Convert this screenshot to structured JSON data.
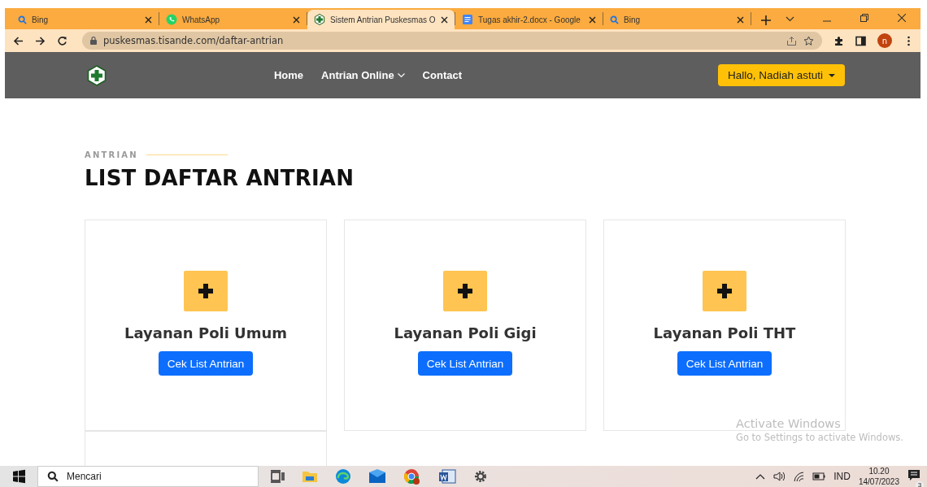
{
  "browser": {
    "tabs": [
      {
        "title": "Bing",
        "kind": "search",
        "selected": false
      },
      {
        "title": "WhatsApp",
        "kind": "chat",
        "selected": false
      },
      {
        "title": "Sistem Antrian Puskesmas O",
        "kind": "site",
        "selected": true
      },
      {
        "title": "Tugas akhir-2.docx - Google",
        "kind": "doc",
        "selected": false
      },
      {
        "title": "Bing",
        "kind": "search",
        "selected": false
      }
    ],
    "address": "puskesmas.tisande.com/daftar-antrian",
    "profile_initial": "n"
  },
  "navbar": {
    "links": [
      {
        "label": "Home",
        "dropdown": false
      },
      {
        "label": "Antrian Online",
        "dropdown": true
      },
      {
        "label": "Contact",
        "dropdown": false
      }
    ],
    "user_button": "Hallo, Nadiah astuti"
  },
  "section": {
    "eyebrow": "ANTRIAN",
    "title": "LIST DAFTAR ANTRIAN"
  },
  "cards": [
    {
      "kind": "service",
      "title": "Layanan Poli Umum",
      "button": "Cek List Antrian"
    },
    {
      "kind": "service",
      "title": "Layanan Poli Gigi",
      "button": "Cek List Antrian"
    },
    {
      "kind": "service",
      "title": "Layanan Poli THT",
      "button": "Cek List Antrian"
    },
    {
      "kind": "clipped"
    }
  ],
  "activation": {
    "title": "Activate Windows",
    "subtitle": "Go to Settings to activate Windows."
  },
  "taskbar": {
    "search_placeholder": "Mencari",
    "language": "IND",
    "time": "10.20",
    "date": "14/07/2023",
    "notification_count": "3"
  }
}
